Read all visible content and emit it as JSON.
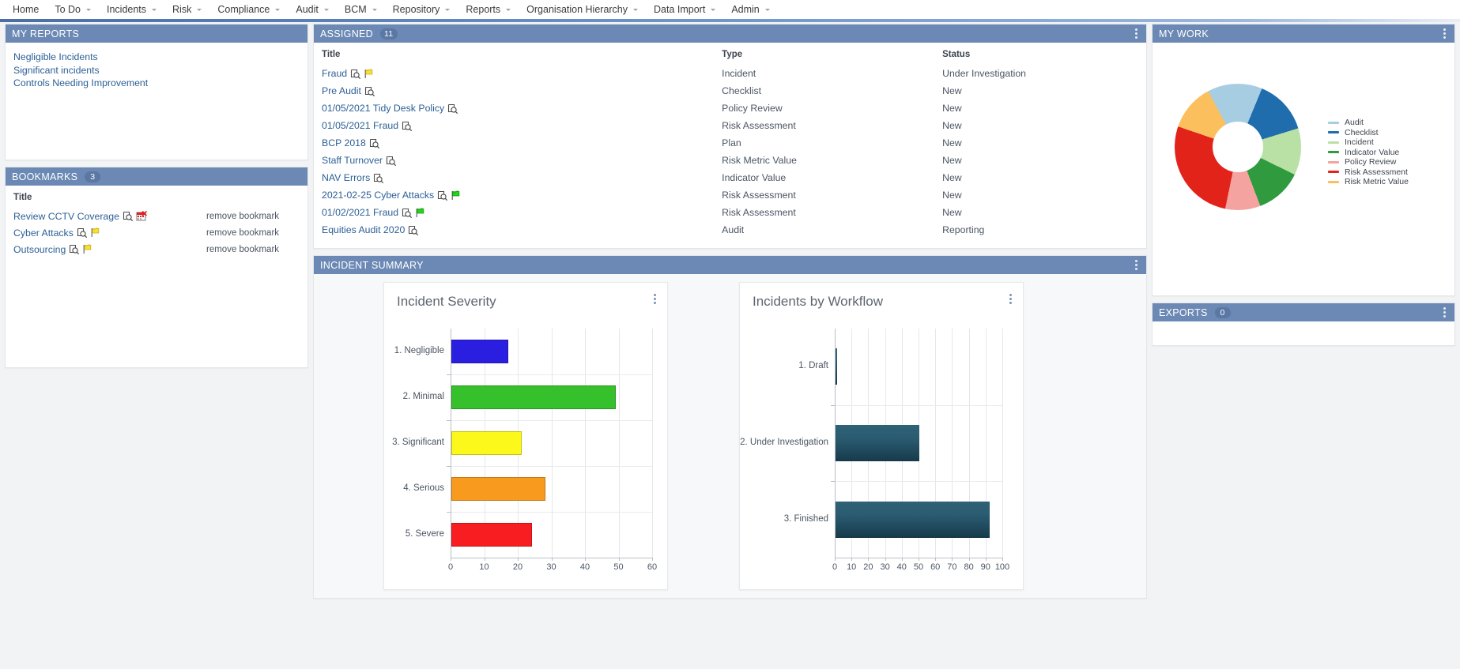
{
  "nav": {
    "items": [
      {
        "label": "Home",
        "caret": false
      },
      {
        "label": "To Do",
        "caret": true
      },
      {
        "label": "Incidents",
        "caret": true
      },
      {
        "label": "Risk",
        "caret": true
      },
      {
        "label": "Compliance",
        "caret": true
      },
      {
        "label": "Audit",
        "caret": true
      },
      {
        "label": "BCM",
        "caret": true
      },
      {
        "label": "Repository",
        "caret": true
      },
      {
        "label": "Reports",
        "caret": true
      },
      {
        "label": "Organisation Hierarchy",
        "caret": true
      },
      {
        "label": "Data Import",
        "caret": true
      },
      {
        "label": "Admin",
        "caret": true
      }
    ]
  },
  "my_reports": {
    "title": "MY REPORTS",
    "links": [
      "Negligible Incidents",
      "Significant incidents",
      "Controls Needing Improvement"
    ]
  },
  "bookmarks": {
    "title": "BOOKMARKS",
    "count": "3",
    "column_header": "Title",
    "remove_label": "remove bookmark",
    "rows": [
      {
        "title": "Review CCTV Coverage",
        "icons": [
          "preview-icon",
          "calendar-alert-icon"
        ]
      },
      {
        "title": "Cyber Attacks",
        "icons": [
          "preview-icon",
          "flag-yellow-icon"
        ]
      },
      {
        "title": "Outsourcing",
        "icons": [
          "preview-icon",
          "flag-yellow-icon"
        ]
      }
    ]
  },
  "assigned": {
    "title": "ASSIGNED",
    "count": "11",
    "headers": {
      "title": "Title",
      "type": "Type",
      "status": "Status"
    },
    "rows": [
      {
        "title": "Fraud",
        "type": "Incident",
        "status": "Under Investigation",
        "icons": [
          "preview-icon",
          "flag-yellow-icon"
        ]
      },
      {
        "title": "Pre Audit",
        "type": "Checklist",
        "status": "New",
        "icons": [
          "preview-icon"
        ]
      },
      {
        "title": "01/05/2021 Tidy Desk Policy",
        "type": "Policy Review",
        "status": "New",
        "icons": [
          "preview-icon"
        ]
      },
      {
        "title": "01/05/2021 Fraud",
        "type": "Risk Assessment",
        "status": "New",
        "icons": [
          "preview-icon"
        ]
      },
      {
        "title": "BCP 2018",
        "type": "Plan",
        "status": "New",
        "icons": [
          "preview-icon"
        ]
      },
      {
        "title": "Staff Turnover",
        "type": "Risk Metric Value",
        "status": "New",
        "icons": [
          "preview-icon"
        ]
      },
      {
        "title": "NAV Errors",
        "type": "Indicator Value",
        "status": "New",
        "icons": [
          "preview-icon"
        ]
      },
      {
        "title": "2021-02-25 Cyber Attacks",
        "type": "Risk Assessment",
        "status": "New",
        "icons": [
          "preview-icon",
          "flag-green-icon"
        ]
      },
      {
        "title": "01/02/2021 Fraud",
        "type": "Risk Assessment",
        "status": "New",
        "icons": [
          "preview-icon",
          "flag-green-icon"
        ]
      },
      {
        "title": "Equities Audit 2020",
        "type": "Audit",
        "status": "Reporting",
        "icons": [
          "preview-icon"
        ]
      }
    ]
  },
  "incident_summary": {
    "title": "INCIDENT SUMMARY"
  },
  "my_work": {
    "title": "MY WORK",
    "legend": [
      {
        "label": "Audit",
        "color": "#a7cde3"
      },
      {
        "label": "Checklist",
        "color": "#1f6dad"
      },
      {
        "label": "Incident",
        "color": "#b9e0a5"
      },
      {
        "label": "Indicator Value",
        "color": "#2f9a3e"
      },
      {
        "label": "Policy Review",
        "color": "#f4a3a0"
      },
      {
        "label": "Risk Assessment",
        "color": "#e2231a"
      },
      {
        "label": "Risk Metric Value",
        "color": "#fbbf5e"
      }
    ]
  },
  "exports": {
    "title": "EXPORTS",
    "count": "0"
  },
  "chart_data": [
    {
      "type": "bar",
      "orientation": "horizontal",
      "title": "Incident Severity",
      "categories": [
        "1. Negligible",
        "2. Minimal",
        "3. Significant",
        "4. Serious",
        "5. Severe"
      ],
      "values": [
        17,
        49,
        21,
        28,
        24
      ],
      "colors": [
        "#2a1fe0",
        "#36c02c",
        "#fcf81c",
        "#f79a1e",
        "#f81d20"
      ],
      "xlabel": "",
      "ylabel": "",
      "xlim": [
        0,
        60
      ],
      "xticks": [
        0,
        10,
        20,
        30,
        40,
        50,
        60
      ],
      "grid": true,
      "legend": "none"
    },
    {
      "type": "bar",
      "orientation": "horizontal",
      "title": "Incidents by Workflow",
      "categories": [
        "1. Draft",
        "2. Under Investigation",
        "3. Finished"
      ],
      "values": [
        1,
        50,
        92
      ],
      "colors": [
        "#1f4e63",
        "#1f4e63",
        "#1f4e63"
      ],
      "xlabel": "",
      "ylabel": "",
      "xlim": [
        0,
        100
      ],
      "xticks": [
        0,
        10,
        20,
        30,
        40,
        50,
        60,
        70,
        80,
        90,
        100
      ],
      "grid": true,
      "legend": "none"
    },
    {
      "type": "pie",
      "subtype": "donut",
      "title": "My Work",
      "labels": [
        "Audit",
        "Checklist",
        "Incident",
        "Indicator Value",
        "Policy Review",
        "Risk Assessment",
        "Risk Metric Value"
      ],
      "values": [
        14,
        14,
        12,
        12,
        9,
        27,
        12
      ],
      "colors": [
        "#a7cde3",
        "#1f6dad",
        "#b9e0a5",
        "#2f9a3e",
        "#f4a3a0",
        "#e2231a",
        "#fbbf5e"
      ],
      "legend": "right"
    }
  ]
}
